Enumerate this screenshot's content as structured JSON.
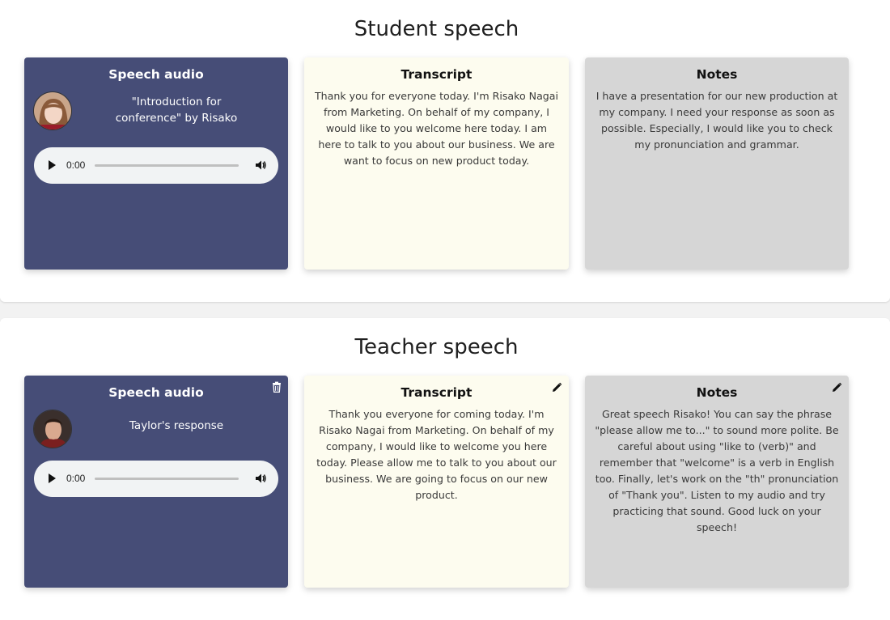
{
  "student": {
    "section_title": "Student speech",
    "audio": {
      "title": "Speech audio",
      "caption": "\"Introduction for conference\" by Risako",
      "time": "0:00"
    },
    "transcript": {
      "title": "Transcript",
      "text": "Thank you for everyone today. I'm Risako Nagai from Marketing. On behalf of my company, I would like to you welcome here today. I am here to talk to you about our business. We are want to focus on new product today."
    },
    "notes": {
      "title": "Notes",
      "text": "I have a presentation for our new production at my company. I need your response as soon as possible. Especially, I would like you to check my pronunciation and grammar."
    }
  },
  "teacher": {
    "section_title": "Teacher speech",
    "audio": {
      "title": "Speech audio",
      "caption": "Taylor's response",
      "time": "0:00"
    },
    "transcript": {
      "title": "Transcript",
      "text": "Thank you everyone for coming today. I'm Risako Nagai from Marketing. On behalf of my company, I would like to welcome you here today. Please allow me to talk to you about our business. We are going to focus on our new product."
    },
    "notes": {
      "title": "Notes",
      "text": "Great speech Risako! You can say the phrase \"please allow me to...\" to sound more polite. Be careful about using \"like to (verb)\" and remember that \"welcome\" is a verb in English too. Finally, let's work on the \"th\" pronunciation of \"Thank you\". Listen to my audio and try practicing that sound. Good luck on your speech!"
    }
  },
  "colors": {
    "audio_card": "#464d77",
    "transcript_card": "#fdfcef",
    "notes_card": "#d6d6d6",
    "player_bg": "#f1f3f4"
  },
  "icons": {
    "play": "play-icon",
    "volume": "volume-icon",
    "delete": "trash-icon",
    "edit": "pencil-icon"
  }
}
